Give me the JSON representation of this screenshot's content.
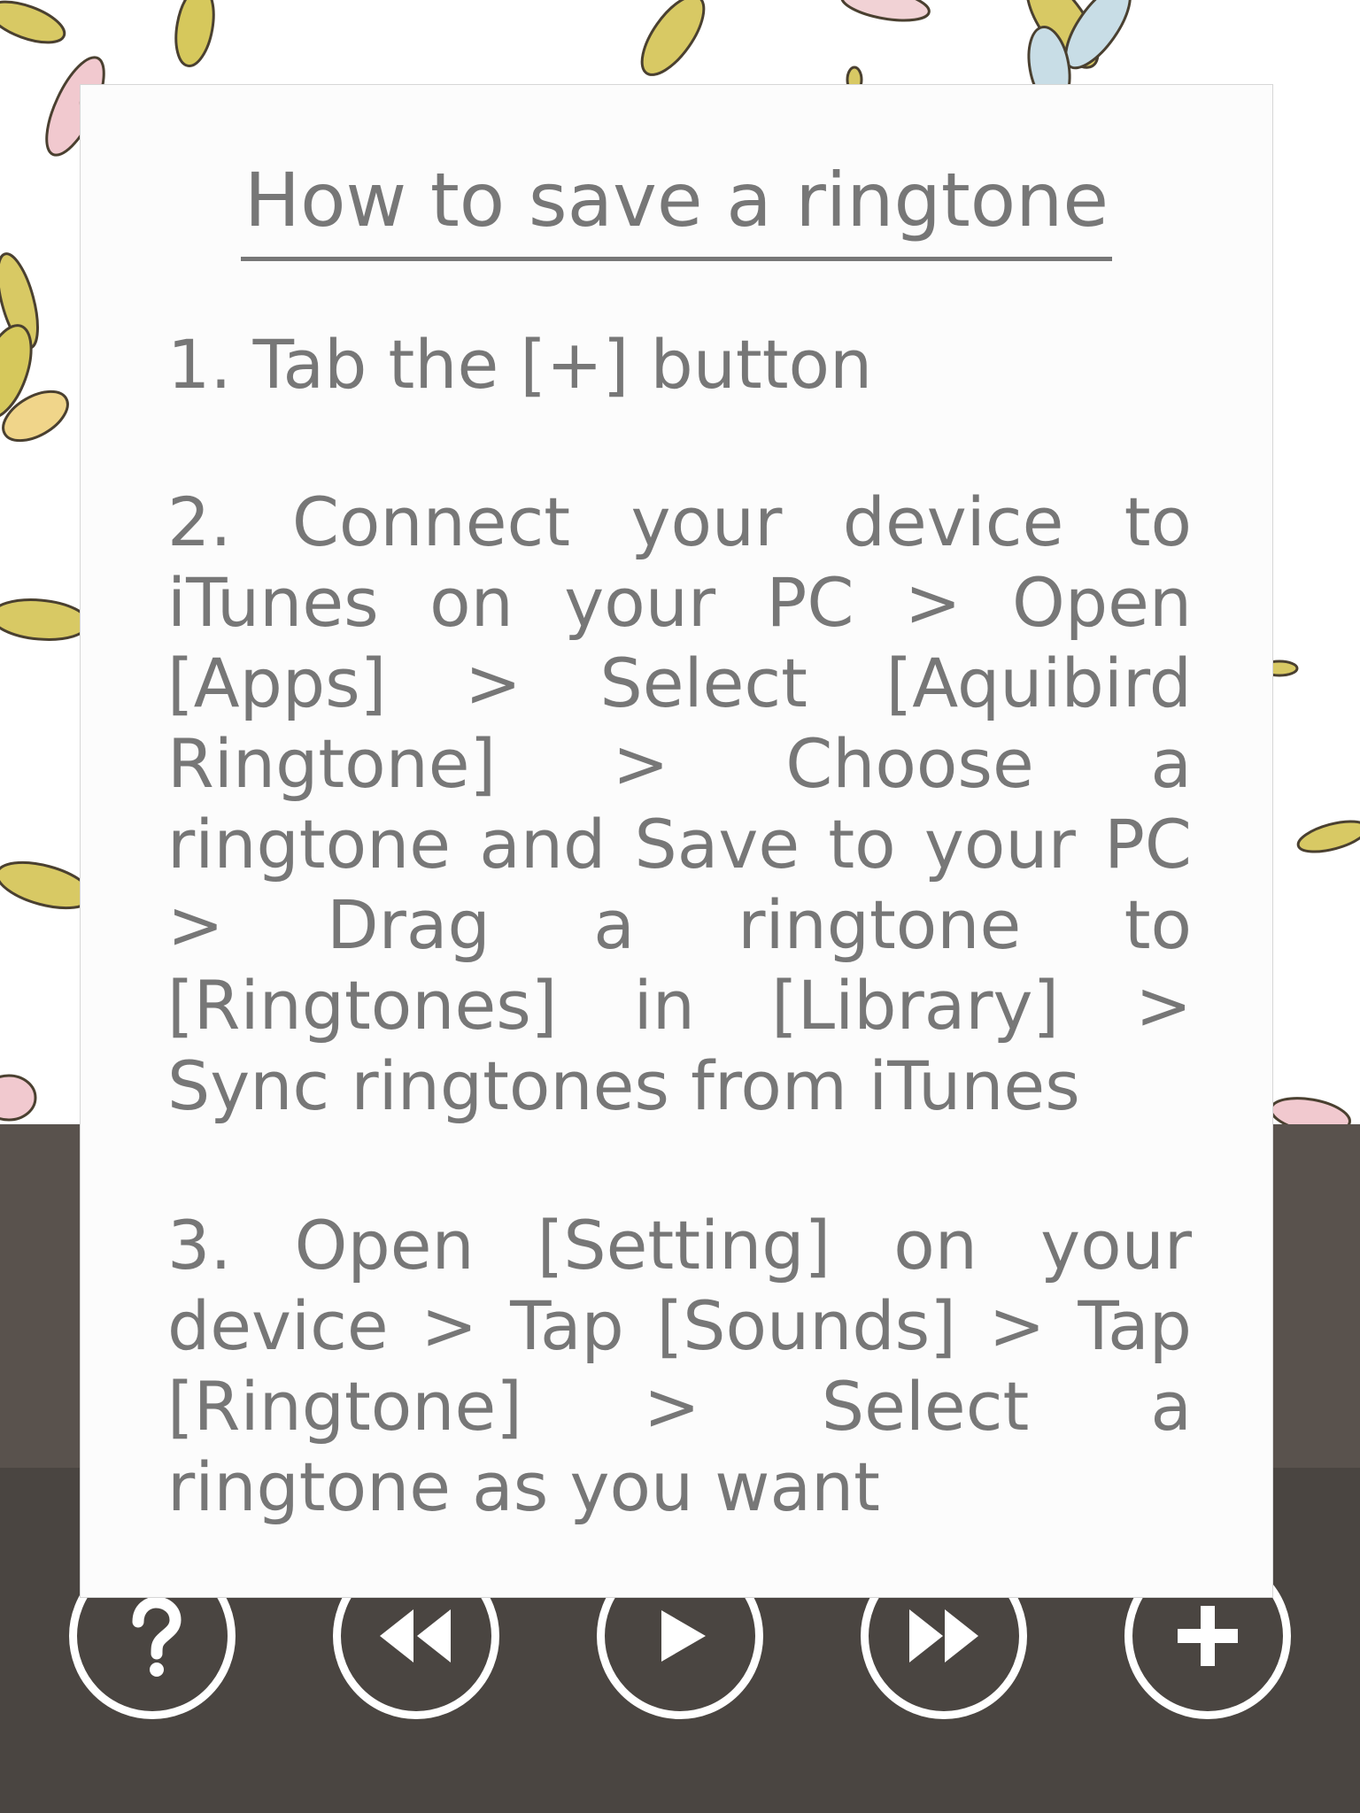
{
  "dialog": {
    "title": "How to save a ringtone",
    "steps": [
      "1. Tab the [+] button",
      "2. Connect your device to iTunes on your PC > Open [Apps] > Select [Aquibird Ringtone] > Choose a ringtone and Save to your PC > Drag a ringtone to [Ringtones] in [Library] > Sync ringtones from iTunes",
      "3. Open [Setting] on your device > Tap [Sounds] > Tap [Ringtone] > Select a ringtone as you want"
    ]
  },
  "controls": [
    {
      "name": "help-button",
      "icon": "question-mark-icon"
    },
    {
      "name": "rewind-button",
      "icon": "rewind-icon"
    },
    {
      "name": "play-button",
      "icon": "play-icon"
    },
    {
      "name": "fast-forward-button",
      "icon": "fast-forward-icon"
    },
    {
      "name": "add-button",
      "icon": "plus-icon"
    }
  ],
  "colors": {
    "dialog_text": "#777777",
    "dialog_background": "#fcfcfc",
    "info_band": "#59524d",
    "control_bar": "#4a4541",
    "button_outline": "#ffffff"
  }
}
